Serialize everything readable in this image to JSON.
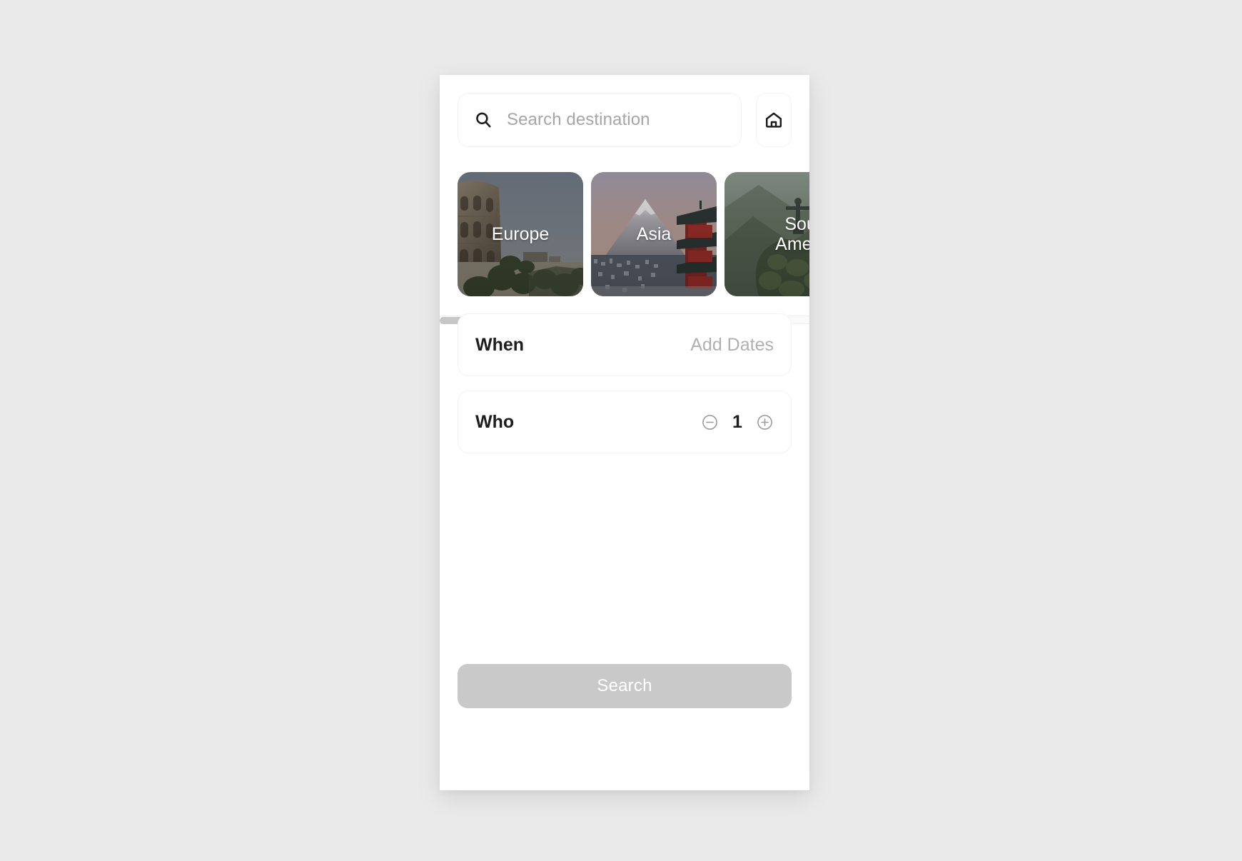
{
  "search": {
    "placeholder": "Search destination",
    "value": "",
    "icon": "search-icon",
    "home_icon": "home-icon"
  },
  "destinations": {
    "items": [
      {
        "label": "Europe",
        "image": "colosseum-rome"
      },
      {
        "label": "Asia",
        "image": "mount-fuji-pagoda"
      },
      {
        "label": "South America",
        "image": "christ-the-redeemer-rio"
      }
    ]
  },
  "fields": {
    "when": {
      "label": "When",
      "value": "Add Dates"
    },
    "who": {
      "label": "Who",
      "count": "1",
      "decrement_icon": "minus-circle-icon",
      "increment_icon": "plus-circle-icon"
    }
  },
  "actions": {
    "search_label": "Search"
  },
  "colors": {
    "page_background": "#eaeaea",
    "panel_background": "#ffffff",
    "placeholder_text": "#a6a6a6",
    "label_text": "#1d1d1d",
    "muted_text": "#b0b0b0",
    "search_button_background": "#c9c9c9",
    "search_button_text": "#ffffff",
    "scroll_thumb": "#c6c6c6"
  }
}
